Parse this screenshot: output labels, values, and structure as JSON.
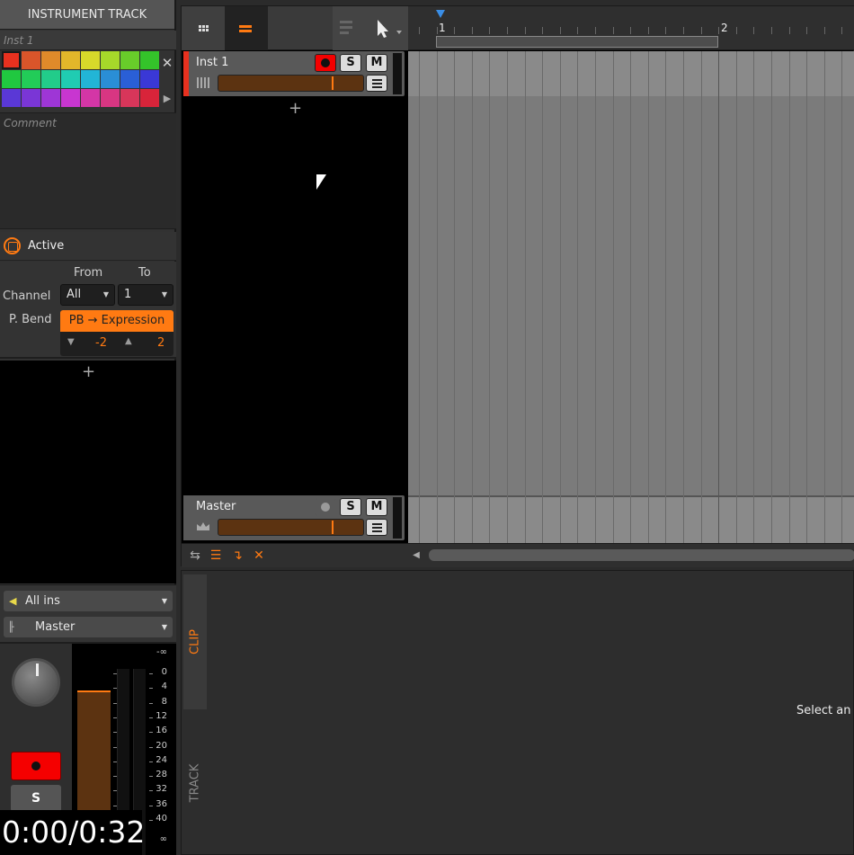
{
  "inspector": {
    "header": "INSTRUMENT TRACK",
    "track_name": "Inst 1",
    "palette": [
      "#e8311f",
      "#d9552a",
      "#e08a2a",
      "#e2b72a",
      "#d7d92a",
      "#a6d82a",
      "#68cc2a",
      "#34c32a",
      "#20c840",
      "#22cc58",
      "#22cc8a",
      "#20ccb2",
      "#22b5d6",
      "#2a8ed6",
      "#2a5fd6",
      "#3a38d6",
      "#5a38d6",
      "#7a36d6",
      "#9e36d6",
      "#c836d0",
      "#d436a6",
      "#d83682",
      "#d8365a",
      "#d8243a"
    ],
    "comment_placeholder": "Comment",
    "note_fx": {
      "active_label": "Active",
      "from_label": "From",
      "to_label": "To",
      "channel_label": "Channel",
      "channel_from": "All",
      "channel_to": "1",
      "pbend_label": "P. Bend",
      "pbend_target": "PB → Expression",
      "pbend_min": "-2",
      "pbend_max": "2"
    },
    "input": "All ins",
    "output": "Master",
    "meter_scale": [
      "-∞",
      "0",
      "4",
      "8",
      "12",
      "16",
      "20",
      "24",
      "28",
      "32",
      "36",
      "40",
      "∞"
    ]
  },
  "arranger": {
    "bars": [
      "1",
      "2"
    ],
    "tracks": [
      {
        "name": "Inst 1",
        "color": "#e8311f",
        "solo": "S",
        "mute": "M"
      },
      {
        "name": "Master",
        "color": "#595959",
        "solo": "S",
        "mute": "M"
      }
    ]
  },
  "detail": {
    "tab_clip": "CLIP",
    "tab_track": "TRACK",
    "message": "Select an a"
  },
  "mixer": {
    "solo": "S"
  },
  "overlay": {
    "time": "0:00/0:32"
  }
}
